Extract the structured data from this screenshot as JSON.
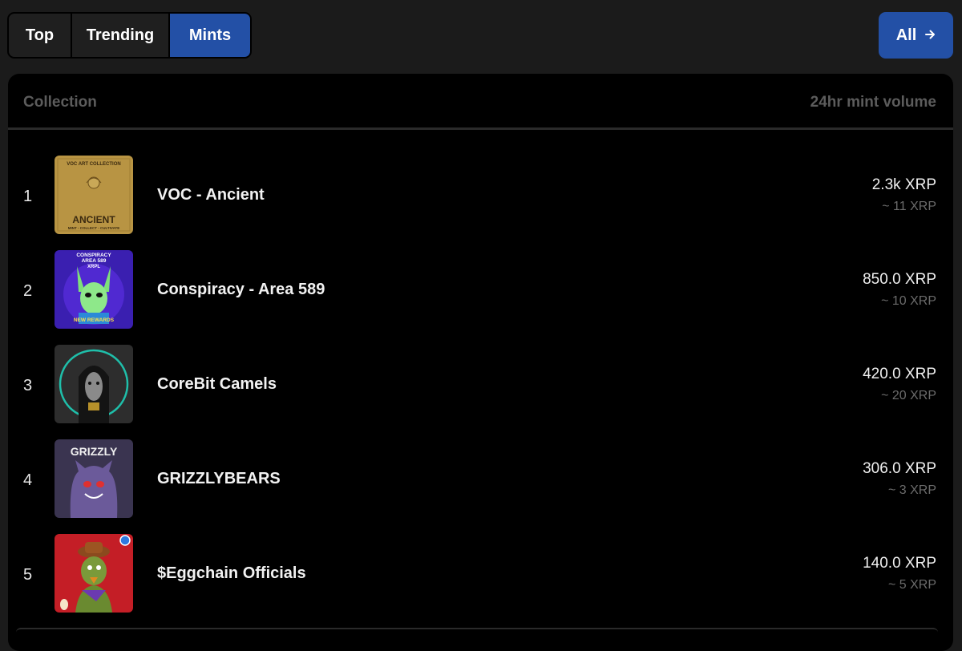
{
  "tabs": [
    {
      "label": "Top",
      "active": false
    },
    {
      "label": "Trending",
      "active": false
    },
    {
      "label": "Mints",
      "active": true
    }
  ],
  "all_button": {
    "label": "All",
    "icon": "arrow-right-icon"
  },
  "table": {
    "col_collection": "Collection",
    "col_volume": "24hr mint volume",
    "rows": [
      {
        "rank": "1",
        "name": "VOC - Ancient",
        "volume": "2.3k XRP",
        "count": "~ 11 XRP",
        "thumb_text_top": "VOC ART COLLECTION",
        "thumb_text_main": "ANCIENT",
        "thumb_text_sub": "MINT - COLLECT - CULTIVATE"
      },
      {
        "rank": "2",
        "name": "Conspiracy - Area 589",
        "volume": "850.0 XRP",
        "count": "~ 10 XRP",
        "thumb_text_top": "CONSPIRACY",
        "thumb_text_main": "AREA 589",
        "thumb_text_sub": "XRPL",
        "thumb_text_bottom": "NEW REWARDS"
      },
      {
        "rank": "3",
        "name": "CoreBit Camels",
        "volume": "420.0 XRP",
        "count": "~ 20 XRP"
      },
      {
        "rank": "4",
        "name": "GRIZZLYBEARS",
        "volume": "306.0 XRP",
        "count": "~ 3 XRP",
        "thumb_text_main": "GRIZZLY"
      },
      {
        "rank": "5",
        "name": "$Eggchain Officials",
        "volume": "140.0 XRP",
        "count": "~ 5 XRP"
      }
    ]
  },
  "colors": {
    "accent": "#2350a6",
    "background": "#1b1b1b",
    "panel": "#000000",
    "muted": "#5c5c5c"
  }
}
